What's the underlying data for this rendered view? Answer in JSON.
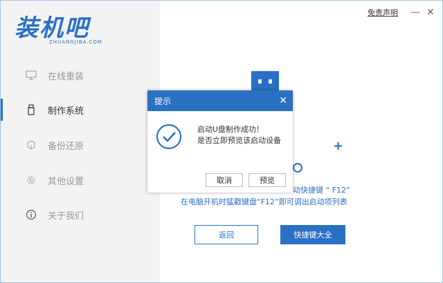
{
  "app": {
    "logo_title": "装机吧",
    "logo_sub": "ZHUANGJIBA.COM",
    "disclaimer_link": "免责声明",
    "minimize_glyph": "—",
    "close_glyph": "✕"
  },
  "sidebar": {
    "items": [
      {
        "label": "在线重装",
        "icon": "monitor-icon",
        "active": false
      },
      {
        "label": "制作系统",
        "icon": "usb-drive-icon",
        "active": true
      },
      {
        "label": "备份还原",
        "icon": "backup-icon",
        "active": false
      },
      {
        "label": "其他设置",
        "icon": "gear-icon",
        "active": false
      },
      {
        "label": "关于我们",
        "icon": "info-icon",
        "active": false
      }
    ]
  },
  "main": {
    "hint_line1_visible": "动快捷键 “ F12”",
    "hint_line2": "在电脑开机时猛戳键盘“F12”即可调出启动项列表",
    "back_button": "返回",
    "shortcut_button": "快捷键大全"
  },
  "dialog": {
    "title": "提示",
    "message_line1": "启动U盘制作成功！",
    "message_line2": "是否立即预览该启动设备",
    "cancel_button": "取消",
    "preview_button": "预览"
  },
  "colors": {
    "accent": "#2a71c4",
    "sidebar_bg": "#f3f3f4"
  }
}
